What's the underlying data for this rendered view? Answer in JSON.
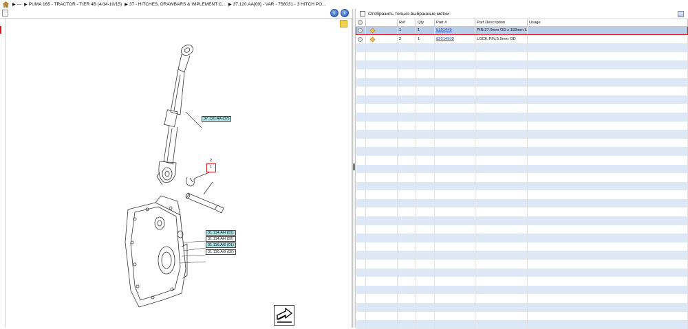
{
  "breadcrumb": {
    "home_icon": "home-icon",
    "items": [
      "---",
      "PUMA 165 - TRACTOR - TIER 4B (4/14-10/15)",
      "37 - HITCHES, DRAWBARS & IMPLEMENT C...",
      "37.120.AA[09] - VAR - 758031 - 3 HITCH PO..."
    ]
  },
  "diagram": {
    "callouts": [
      {
        "label": "37.120.AA (07)",
        "style": "teal"
      },
      {
        "label": "31.114.AH (01)",
        "style": "teal"
      },
      {
        "label": "31.114.AH (02)",
        "style": "plain"
      },
      {
        "label": "31.116.AG (01)",
        "style": "teal"
      },
      {
        "label": "31.116.AG (02)",
        "style": "plain"
      }
    ],
    "refs": [
      "2",
      "1"
    ]
  },
  "filter": {
    "label": "Отобразить только выбранные метки",
    "checked": false
  },
  "table": {
    "columns": [
      "",
      "",
      "Ref",
      "Qty",
      "Part #",
      "Part Description",
      "Usage"
    ],
    "rows": [
      {
        "ref": "1",
        "qty": "1",
        "part": "5191449",
        "description": "PIN,27.9mm OD x 152mm L",
        "usage": "",
        "selected": true
      },
      {
        "ref": "2",
        "qty": "1",
        "part": "82014909",
        "description": "LOCK PIN,5.5mm OD",
        "usage": "",
        "selected": false
      }
    ]
  },
  "colors": {
    "selection_red": "#d8141b",
    "row_stripe": "#dde7f6",
    "selected_row": "#b9cde9",
    "callout_teal": "#a8e2e6",
    "link_blue": "#1a3fd0"
  }
}
